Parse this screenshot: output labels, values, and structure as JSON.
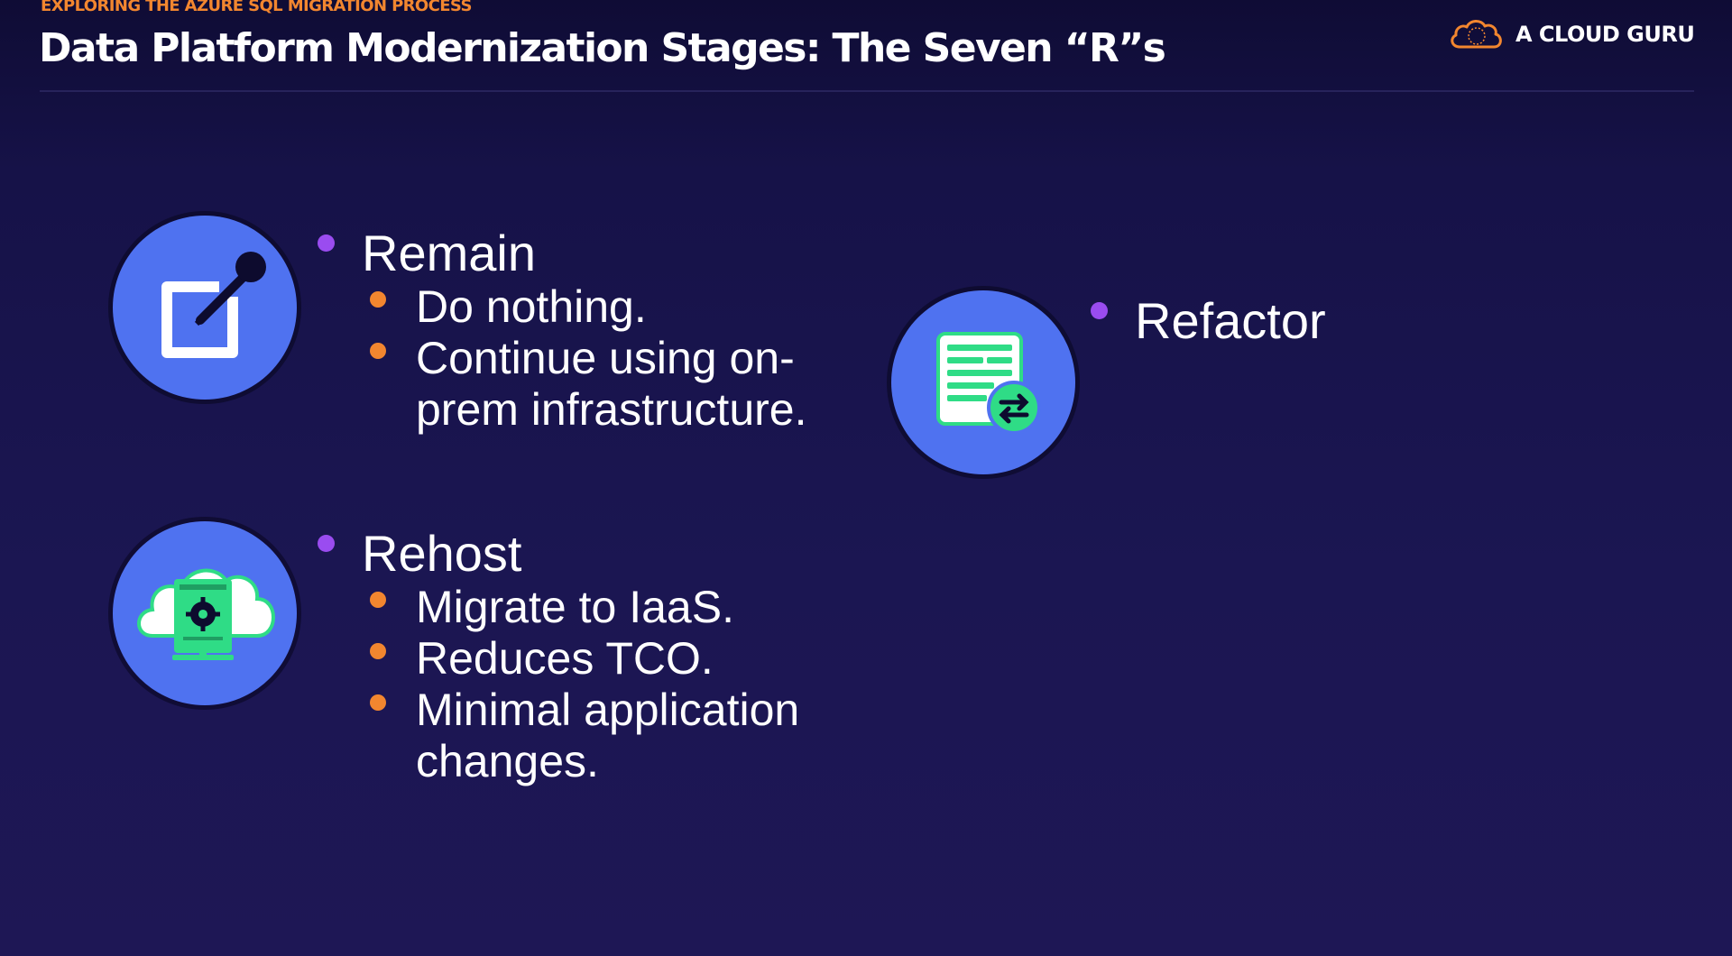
{
  "header": {
    "eyebrow": "EXPLORING THE AZURE SQL MIGRATION PROCESS",
    "title": "Data Platform Modernization Stages: The Seven “R”s"
  },
  "brand": {
    "name": "A CLOUD GURU",
    "logo_icon": "cloud-logo-icon"
  },
  "colors": {
    "background": "#1b1652",
    "accent_orange": "#f2862f",
    "accent_purple": "#9a4cf0",
    "icon_circle": "#4f72f0",
    "icon_green": "#2fdc86"
  },
  "stages": [
    {
      "name": "Remain",
      "icon": "edit-pencil-icon",
      "points": [
        "Do nothing.",
        "Continue using on-\nprem infrastructure."
      ]
    },
    {
      "name": "Rehost",
      "icon": "cloud-server-icon",
      "points": [
        "Migrate to IaaS.",
        "Reduces TCO.",
        "Minimal application\nchanges."
      ]
    },
    {
      "name": "Refactor",
      "icon": "document-refresh-icon",
      "points": []
    }
  ]
}
